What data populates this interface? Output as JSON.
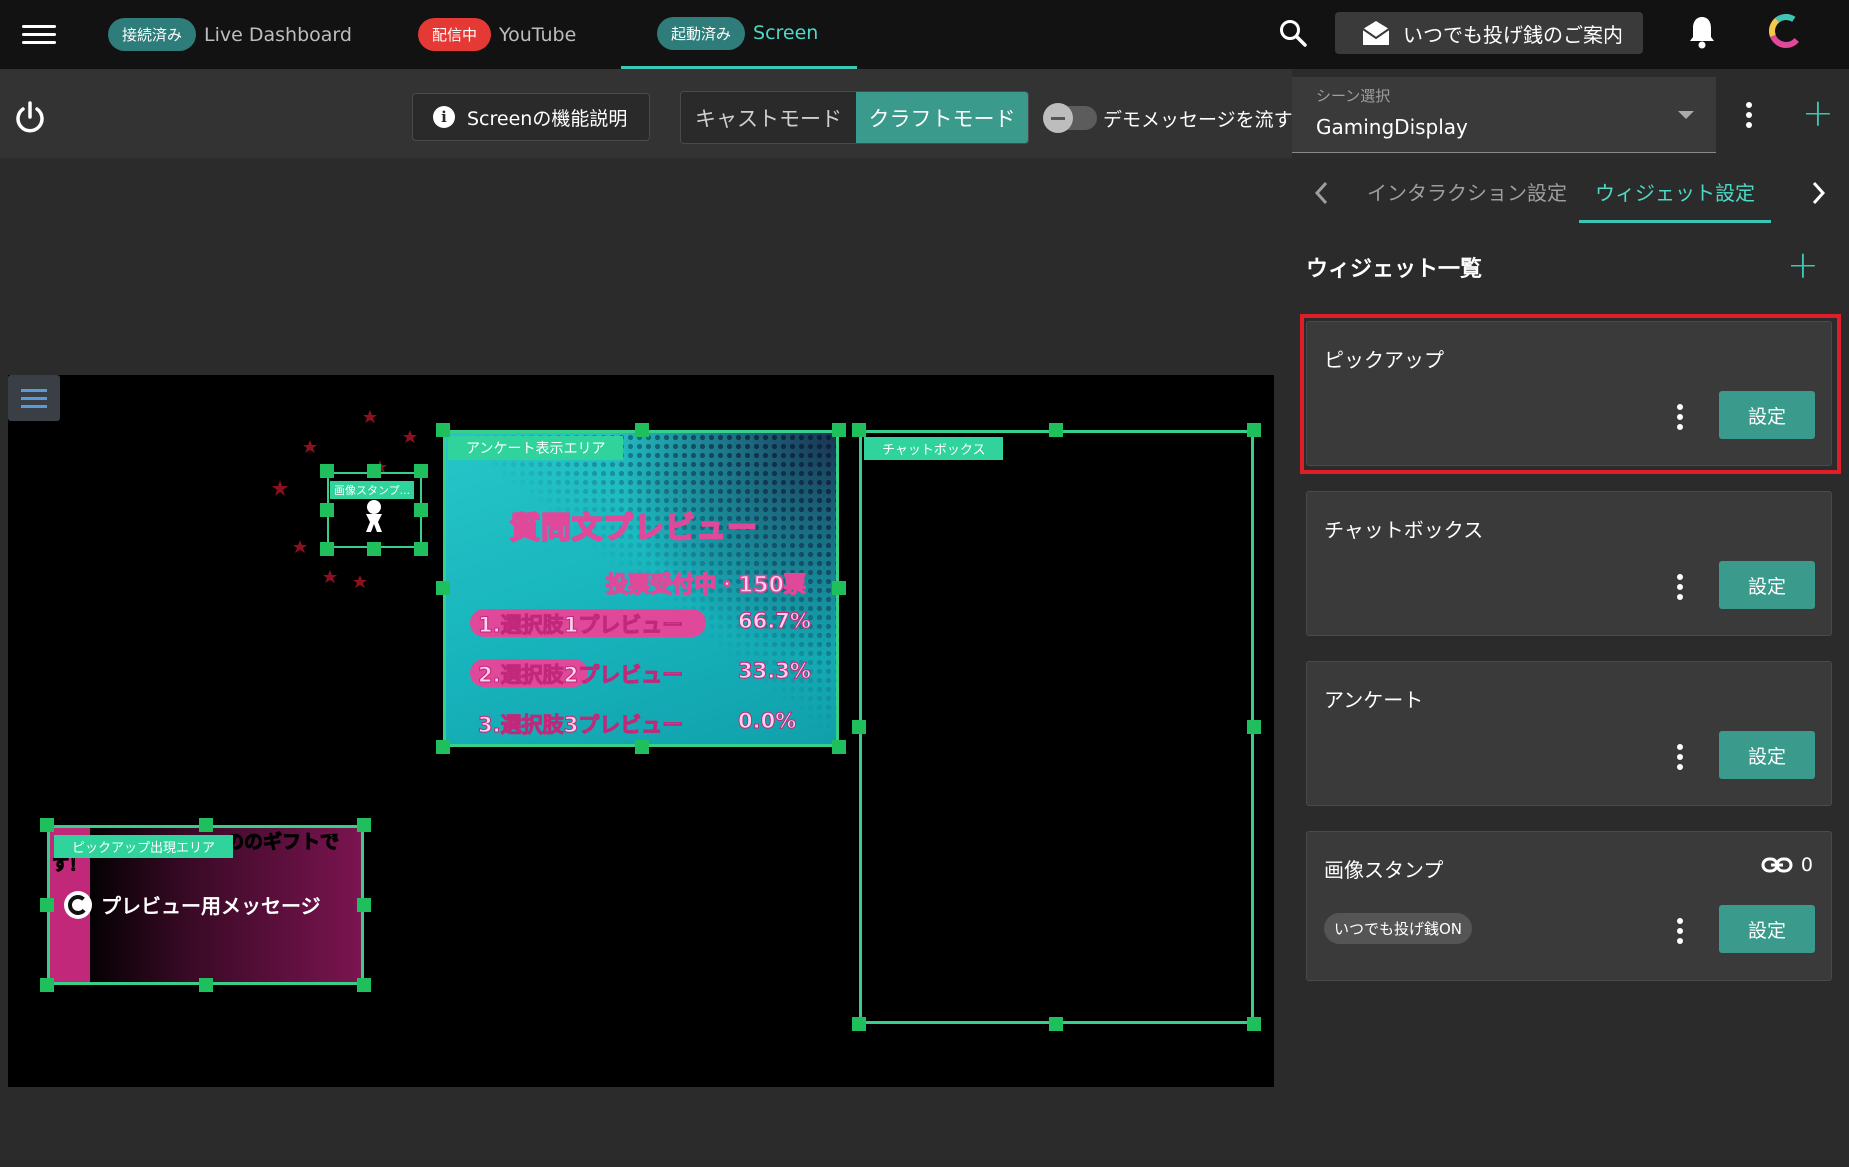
{
  "topbar": {
    "tabs": [
      {
        "badge": "接続済み",
        "label": "Live Dashboard",
        "badge_color": "#2e7d7a"
      },
      {
        "badge": "配信中",
        "label": "YouTube",
        "badge_color": "#e53935"
      },
      {
        "badge": "起動済み",
        "label": "Screen",
        "badge_color": "#2e7d7a",
        "active": true
      }
    ],
    "guide_button": "いつでも投げ銭のご案内"
  },
  "toolbar": {
    "help_button": "Screenの機能説明",
    "modes": [
      "キャストモード",
      "クラフトモード"
    ],
    "selected_mode": "クラフトモード",
    "demo_toggle_label": "デモメッセージを流す",
    "demo_toggle_on": false
  },
  "canvas": {
    "widgets": {
      "stamp_tag": "画像スタンプ...",
      "poll_tag": "アンケート表示エリア",
      "chat_tag": "チャットボックス",
      "pickup_tag": "ピックアップ出現エリア"
    },
    "poll": {
      "question": "質問文プレビュー",
      "status": "投票受付中・150票",
      "options": [
        {
          "label": "1.選択肢1プレビュー",
          "percent": "66.7%"
        },
        {
          "label": "2.選択肢2プレビュー",
          "percent": "33.3%"
        },
        {
          "label": "3.選択肢3プレビュー",
          "percent": "0.0%"
        }
      ]
    },
    "pickup": {
      "header": "ののギフトで",
      "header2": "す！",
      "message": "プレビュー用メッセージ"
    }
  },
  "sidebar": {
    "scene": {
      "label": "シーン選択",
      "value": "GamingDisplay"
    },
    "tabs": [
      "インタラクション設定",
      "ウィジェット設定"
    ],
    "active_tab": "ウィジェット設定",
    "widget_list_title": "ウィジェット一覧",
    "widgets": [
      {
        "name": "ピックアップ",
        "button": "設定",
        "highlighted": true
      },
      {
        "name": "チャットボックス",
        "button": "設定"
      },
      {
        "name": "アンケート",
        "button": "設定"
      },
      {
        "name": "画像スタンプ",
        "button": "設定",
        "chip": "いつでも投げ銭ON",
        "link_count": "0"
      }
    ]
  },
  "colors": {
    "accent": "#3cc6b3",
    "highlight": "#e01e2a",
    "button": "#3a9a8c"
  }
}
